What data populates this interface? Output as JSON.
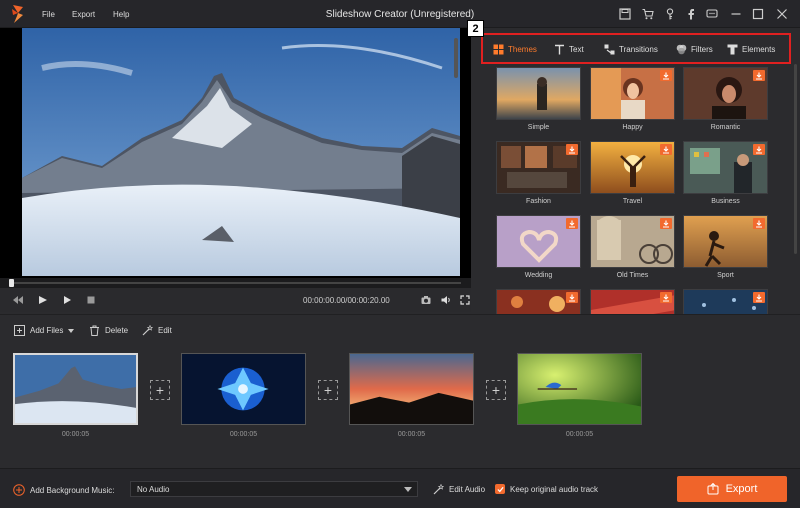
{
  "window": {
    "title": "Slideshow Creator (Unregistered)",
    "menu": [
      "File",
      "Export",
      "Help"
    ],
    "controls": [
      "save-icon",
      "cart-icon",
      "key-icon",
      "facebook-icon",
      "chat-icon",
      "minimize-icon",
      "maximize-icon",
      "close-icon"
    ]
  },
  "player": {
    "timecode": "00:00:00.00/00:00:20.00",
    "progress": 0
  },
  "panel": {
    "callout": "2",
    "tabs": [
      {
        "label": "Themes",
        "icon": "themes-icon",
        "active": true
      },
      {
        "label": "Text",
        "icon": "text-icon"
      },
      {
        "label": "Transitions",
        "icon": "transitions-icon"
      },
      {
        "label": "Filters",
        "icon": "filters-icon"
      },
      {
        "label": "Elements",
        "icon": "elements-icon"
      }
    ],
    "themes": [
      {
        "name": "Simple",
        "download": false
      },
      {
        "name": "Happy",
        "download": true
      },
      {
        "name": "Romantic",
        "download": true
      },
      {
        "name": "Fashion",
        "download": true
      },
      {
        "name": "Travel",
        "download": true
      },
      {
        "name": "Business",
        "download": true
      },
      {
        "name": "Wedding",
        "download": true
      },
      {
        "name": "Old Times",
        "download": true
      },
      {
        "name": "Sport",
        "download": true
      },
      {
        "name": "",
        "download": true
      },
      {
        "name": "",
        "download": true
      },
      {
        "name": "",
        "download": true
      }
    ]
  },
  "toolbar": {
    "add_files": "Add Files",
    "delete": "Delete",
    "edit": "Edit"
  },
  "clips": [
    {
      "duration": "00:00:05",
      "selected": true
    },
    {
      "duration": "00:00:05",
      "selected": false
    },
    {
      "duration": "00:00:05",
      "selected": false
    },
    {
      "duration": "00:00:05",
      "selected": false
    }
  ],
  "bottom": {
    "bg_music_label": "Add Background Music:",
    "audio_value": "No Audio",
    "edit_audio": "Edit Audio",
    "keep_original": "Keep original audio track",
    "keep_original_checked": true,
    "export": "Export"
  },
  "colors": {
    "accent": "#f0642a",
    "highlight_box": "#e02020",
    "background": "#2b2b2e"
  }
}
